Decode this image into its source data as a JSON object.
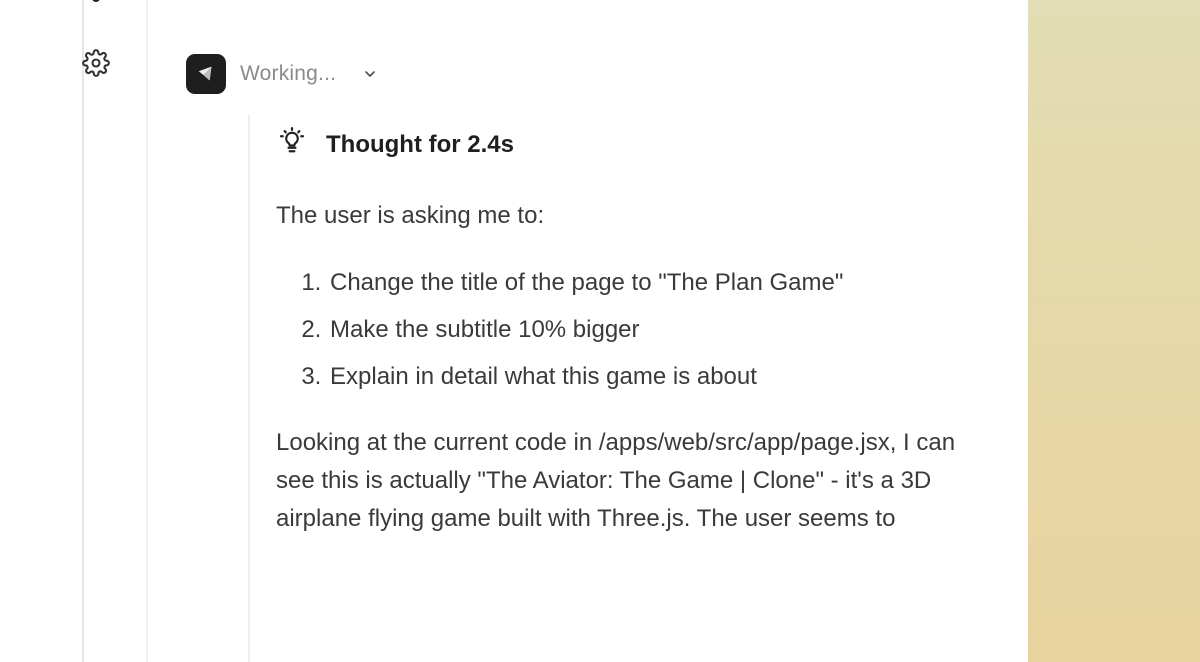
{
  "agent": {
    "status": "Working...",
    "icon": "agent-logo-icon"
  },
  "thought": {
    "title": "Thought for 2.4s",
    "icon": "lightbulb-icon",
    "intro": "The user is asking me to:",
    "steps": [
      "Change the title of the page to \"The Plan Game\"",
      "Make the subtitle 10% bigger",
      "Explain in detail what this game is about"
    ],
    "paragraph": "Looking at the current code in /apps/web/src/app/page.jsx, I can see this is actually \"The Aviator: The Game | Clone\" - it's a 3D airplane flying game built with Three.js. The user seems to"
  },
  "rail": {
    "settings_icon": "gear-icon"
  },
  "colors": {
    "accent_panel": "#e6d7a6",
    "avatar_bg": "#1e1e1e"
  }
}
